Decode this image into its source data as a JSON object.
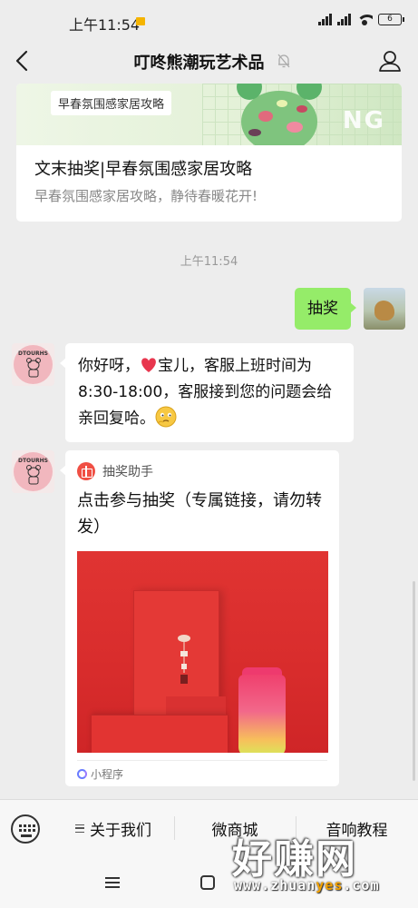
{
  "status_bar": {
    "time": "上午11:54",
    "battery": "6"
  },
  "header": {
    "title": "叮咚熊潮玩艺术品"
  },
  "article": {
    "banner_tag": "早春氛围感家居攻略",
    "banner_letters": "NG",
    "title": "文末抽奖|早春氛围感家居攻略",
    "description": "早春氛围感家居攻略，静待春暖花开!"
  },
  "chat": {
    "timestamp": "上午11:54",
    "outgoing_text": "抽奖",
    "avatar_label": "DTOURHS",
    "reply_parts": [
      "你好呀，",
      "宝儿，客服上班时间为 8:30-18:00，客服接到您的问题会给亲回复哈。"
    ],
    "mini_program": {
      "source_name": "抽奖助手",
      "title": "点击参与抽奖（专属链接，请勿转发）",
      "footer_label": "小程序"
    }
  },
  "menu": {
    "items": [
      "关于我们",
      "微商城",
      "音响教程"
    ]
  },
  "watermark": {
    "text": "好赚网",
    "url_prefix": "www.zhuan",
    "url_highlight": "yes",
    "url_suffix": ".com"
  },
  "colors": {
    "outgoing_bubble": "#95ec69",
    "background": "#ededed",
    "gift_icon": "#f04f44"
  }
}
